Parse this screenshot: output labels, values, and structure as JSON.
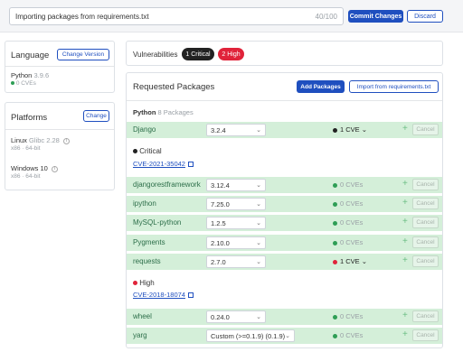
{
  "topbar": {
    "commit_message": "Importing packages from requirements.txt",
    "char_count": "40/100",
    "commit_label": "Commit Changes",
    "discard_label": "Discard"
  },
  "language": {
    "title": "Language",
    "change_version_label": "Change Version",
    "name": "Python",
    "version": "3.9.6",
    "cves": "0 CVEs"
  },
  "platforms": {
    "title": "Platforms",
    "change_label": "Change",
    "items": [
      {
        "name": "Linux",
        "version": "Glibc 2.28",
        "arch": "x86 · 64-bit"
      },
      {
        "name": "Windows 10",
        "version": "",
        "arch": "x86 · 64-bit"
      }
    ]
  },
  "vulnerabilities": {
    "label": "Vulnerabilities",
    "critical": "1 Critical",
    "high": "2 High",
    "colors": {
      "critical": "#222222",
      "high": "#e0233a"
    }
  },
  "requested": {
    "title": "Requested Packages",
    "add_label": "Add Packages",
    "import_label": "Import from requirements.txt",
    "group_name": "Python",
    "group_count": "8 Packages",
    "cancel_label": "Cancel",
    "packages": [
      {
        "name": "Django",
        "version": "3.2.4",
        "cve": "1 CVE"
      },
      {
        "name": "djangorestframework",
        "version": "3.12.4",
        "cve": "0 CVEs"
      },
      {
        "name": "ipython",
        "version": "7.25.0",
        "cve": "0 CVEs"
      },
      {
        "name": "MySQL-python",
        "version": "1.2.5",
        "cve": "0 CVEs"
      },
      {
        "name": "Pygments",
        "version": "2.10.0",
        "cve": "0 CVEs"
      },
      {
        "name": "requests",
        "version": "2.7.0",
        "cve": "1 CVE"
      },
      {
        "name": "wheel",
        "version": "0.24.0",
        "cve": "0 CVEs"
      },
      {
        "name": "yarg",
        "version": "Custom (>=0.1.9) (0.1.9)",
        "cve": "0 CVEs"
      }
    ],
    "details": [
      {
        "severity": "Critical",
        "cve_id": "CVE-2021-35042"
      },
      {
        "severity": "High",
        "cve_id": "CVE-2018-18074"
      }
    ]
  }
}
